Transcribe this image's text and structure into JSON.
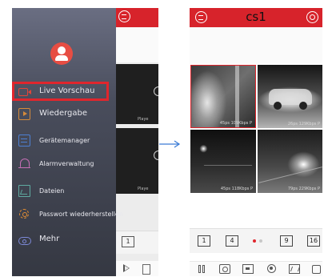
{
  "left_screen": {
    "menu": {
      "items": [
        {
          "label": "Live Vorschau",
          "icon": "live-view-icon",
          "color": "#e0453a"
        },
        {
          "label": "Wiedergabe",
          "icon": "playback-icon",
          "color": "#d58a3a"
        },
        {
          "label": "Gerätemanager",
          "icon": "device-manager-icon",
          "color": "#4d7fd2"
        },
        {
          "label": "Alarmverwaltung",
          "icon": "bell-icon",
          "color": "#c66fb5"
        },
        {
          "label": "Dateien",
          "icon": "files-icon",
          "color": "#5fa9a0"
        },
        {
          "label": "Passwort wiederherstellen",
          "icon": "gear-icon",
          "color": "#e08c33"
        },
        {
          "label": "Mehr",
          "icon": "cloud-icon",
          "color": "#7c89d6"
        }
      ],
      "active": "Live Vorschau",
      "highlight_color": "#e0262d"
    },
    "behind_view": {
      "tile_label": "Playe",
      "page_indicator": "1"
    }
  },
  "right_screen": {
    "header": {
      "title": "cs1",
      "color": "#d7232b"
    },
    "cameras": [
      {
        "label": "45ps 109Kbps P",
        "selected": true
      },
      {
        "label": "26ps 129Kbps P",
        "selected": false
      },
      {
        "label": "45ps 118Kbps P",
        "selected": false
      },
      {
        "label": "79ps 229Kbps P",
        "selected": false
      }
    ],
    "pagination": {
      "layouts": [
        "1",
        "4",
        "9",
        "16"
      ],
      "dots": [
        {
          "color": "#e0262d",
          "active": true
        },
        {
          "color": "#c8c8c8",
          "active": false
        }
      ]
    },
    "toolbar": [
      "pause-icon",
      "camera-icon",
      "record-icon",
      "ptz-icon",
      "layout-icon",
      "more-icon"
    ]
  },
  "arrow_color": "#3a7bd5"
}
